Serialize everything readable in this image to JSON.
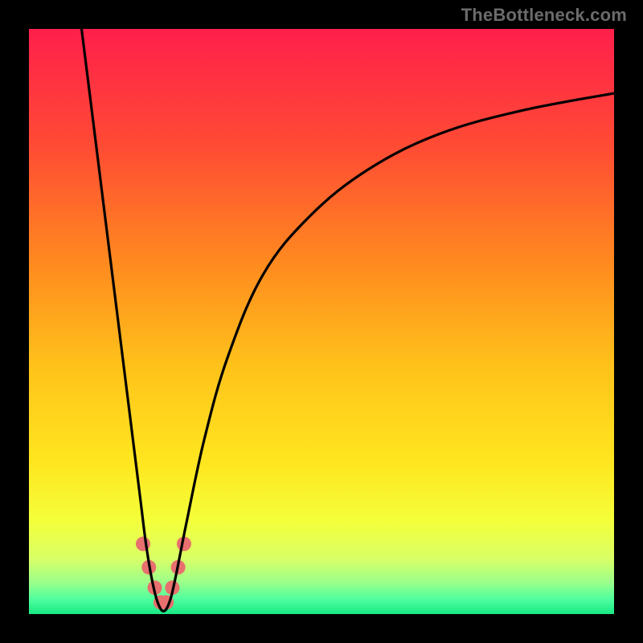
{
  "watermark": "TheBottleneck.com",
  "chart_data": {
    "type": "line",
    "title": "",
    "xlabel": "",
    "ylabel": "",
    "xlim": [
      0,
      100
    ],
    "ylim": [
      0,
      100
    ],
    "grid": false,
    "legend": false,
    "annotations": [],
    "gradient_stops": [
      {
        "pos": 0.0,
        "color": "#ff1f4b"
      },
      {
        "pos": 0.2,
        "color": "#ff4b34"
      },
      {
        "pos": 0.4,
        "color": "#ff8a1f"
      },
      {
        "pos": 0.58,
        "color": "#ffc31a"
      },
      {
        "pos": 0.74,
        "color": "#ffe61f"
      },
      {
        "pos": 0.84,
        "color": "#f4ff3a"
      },
      {
        "pos": 0.905,
        "color": "#d9ff66"
      },
      {
        "pos": 0.945,
        "color": "#9dff8a"
      },
      {
        "pos": 0.975,
        "color": "#4fff9e"
      },
      {
        "pos": 1.0,
        "color": "#17e884"
      }
    ],
    "series": [
      {
        "name": "bottleneck-curve",
        "color": "#000000",
        "x": [
          9.0,
          11.0,
          13.0,
          15.0,
          17.0,
          19.0,
          20.0,
          21.0,
          22.0,
          23.0,
          24.0,
          25.0,
          27.0,
          30.0,
          34.0,
          40.0,
          48.0,
          58.0,
          70.0,
          84.0,
          100.0
        ],
        "values": [
          100.0,
          84.0,
          68.0,
          52.0,
          36.0,
          20.0,
          12.0,
          6.0,
          2.0,
          0.5,
          2.0,
          6.0,
          16.0,
          30.0,
          44.0,
          58.0,
          68.0,
          76.0,
          82.0,
          86.0,
          89.0
        ]
      }
    ],
    "markers": [
      {
        "name": "marker-region",
        "color": "#e8706e",
        "radius_px": 9,
        "x": [
          19.5,
          20.5,
          21.5,
          22.5,
          23.5,
          24.5,
          25.5,
          26.5
        ],
        "values": [
          12.0,
          8.0,
          4.5,
          2.0,
          2.0,
          4.5,
          8.0,
          12.0
        ]
      }
    ]
  }
}
